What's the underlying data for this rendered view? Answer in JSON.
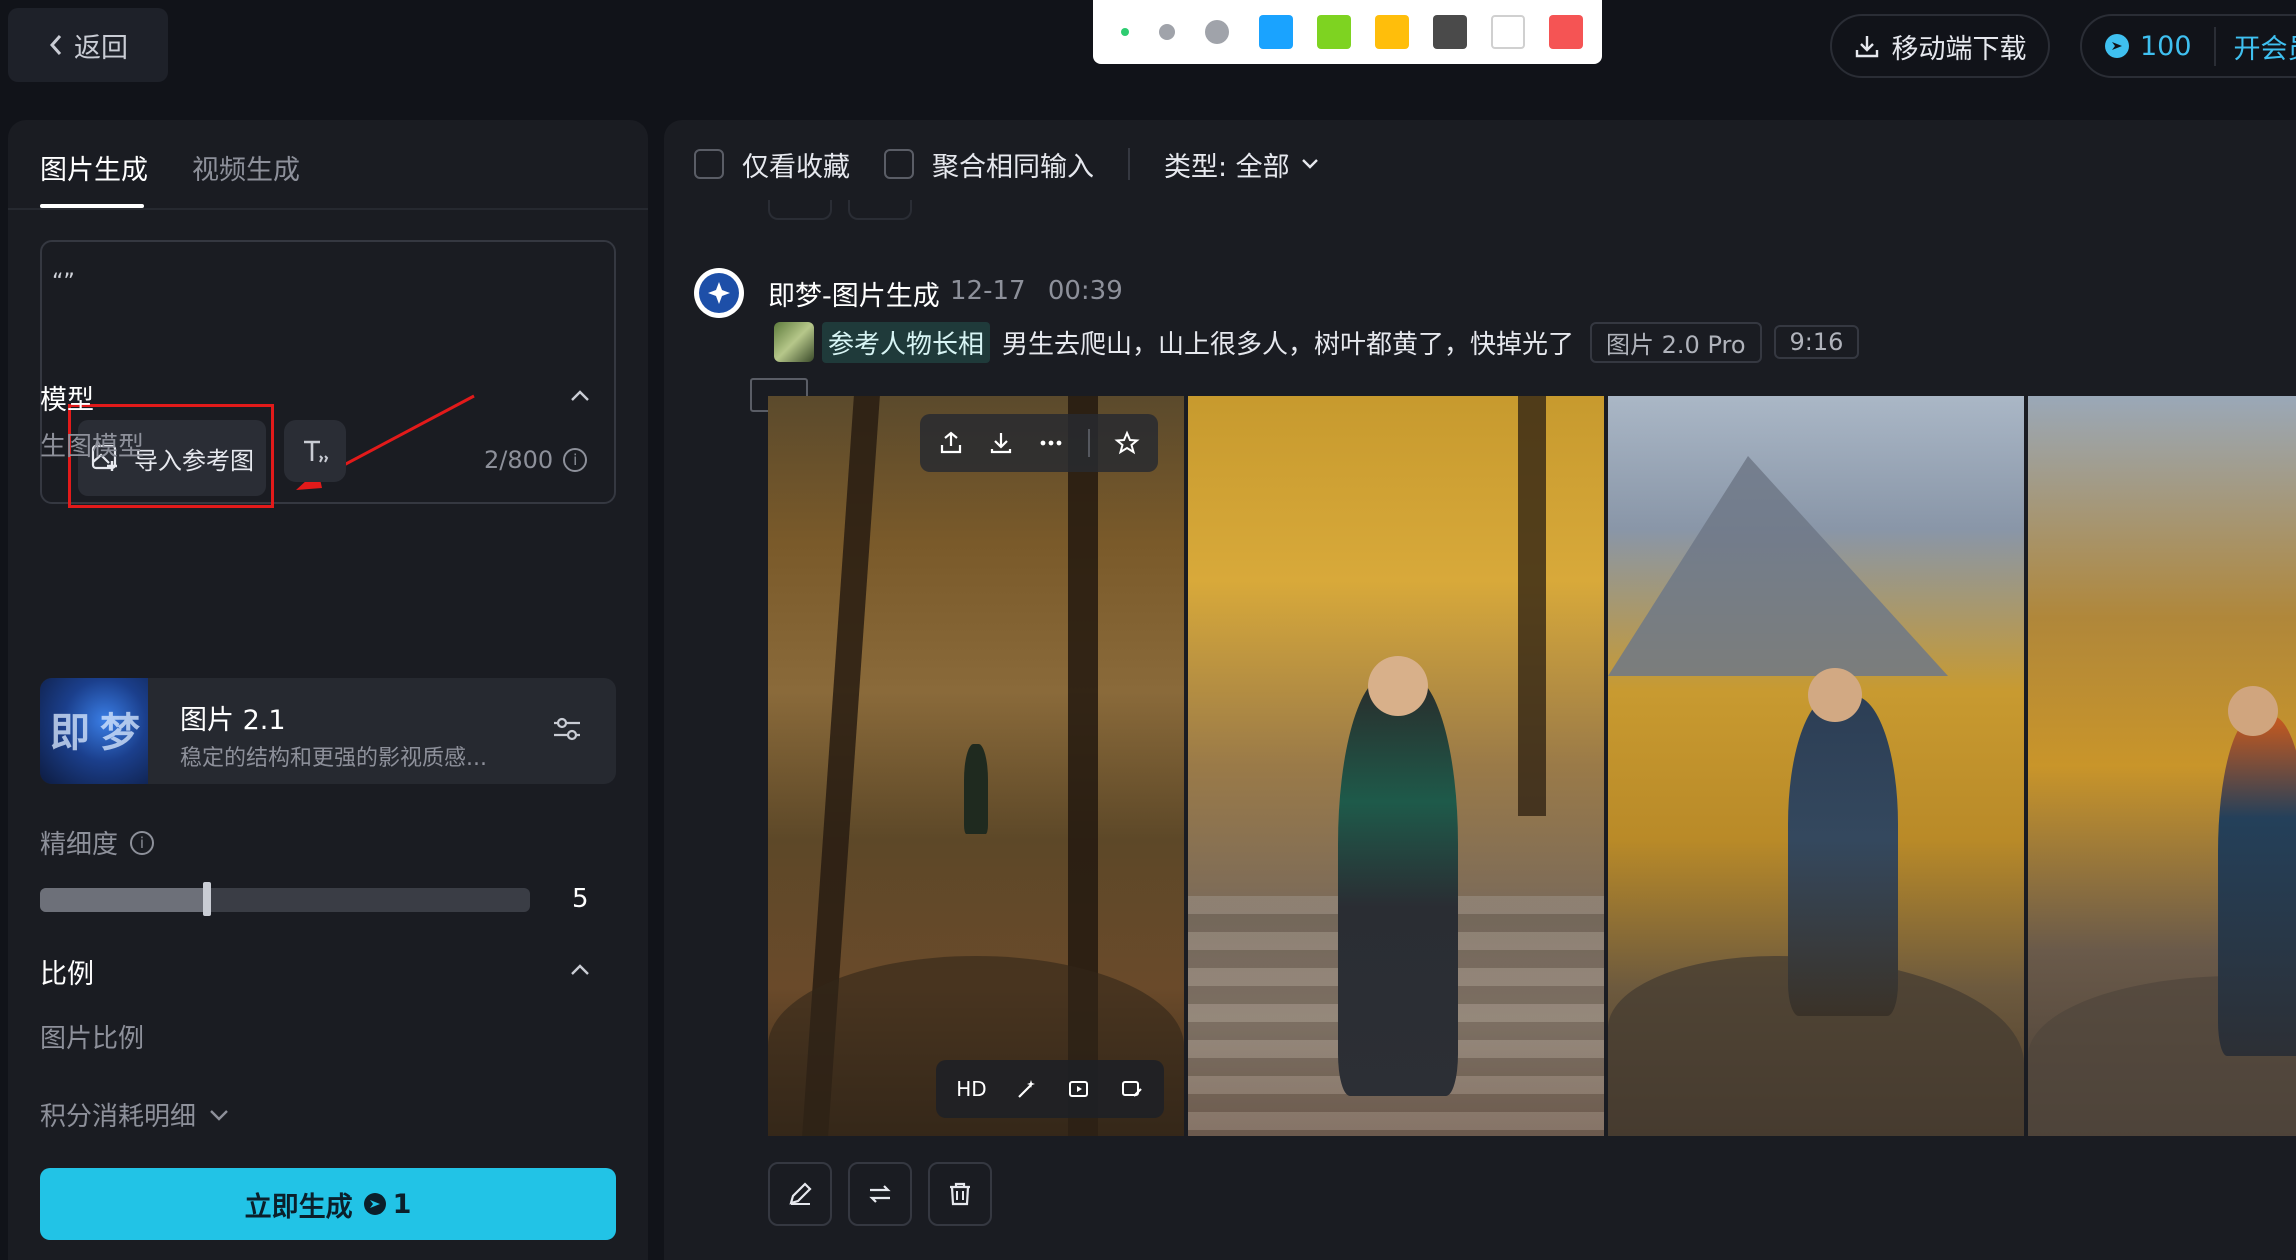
{
  "topbar": {
    "back_label": "返回",
    "palette": {
      "dots": [
        "#2ecc71",
        "#a0a3aa",
        "#a0a3aa"
      ],
      "swatches": [
        "#1aa3ff",
        "#7ed321",
        "#ffbe0b",
        "#4a4a4a",
        "#ffffff",
        "#f55454"
      ]
    },
    "mobile_download_label": "移动端下载",
    "credits_value": "100",
    "vip_label": "开会员"
  },
  "left_panel": {
    "tabs": [
      {
        "label": "图片生成",
        "active": true
      },
      {
        "label": "视频生成",
        "active": false
      }
    ],
    "prompt": {
      "value": "“”",
      "import_label": "导入参考图",
      "counter": "2/800"
    },
    "model_section": {
      "title": "模型",
      "sub_label": "生图模型",
      "model_name": "图片 2.1",
      "model_desc": "稳定的结构和更强的影视质感...",
      "thumb_text": [
        "即",
        "梦"
      ]
    },
    "precision": {
      "label": "精细度",
      "value": "5",
      "fraction": 0.34
    },
    "ratio_section": {
      "title": "比例",
      "sub_label": "图片比例"
    },
    "cost_detail_label": "积分消耗明细",
    "generate": {
      "label": "立即生成",
      "cost": "1"
    }
  },
  "right_panel": {
    "filters": {
      "favorites_label": "仅看收藏",
      "merge_label": "聚合相同输入",
      "type_label": "类型: 全部"
    },
    "message": {
      "author": "即梦-图片生成",
      "date": "12-17",
      "time": "00:39",
      "ref_tag": "参考人物长相",
      "prompt": "男生去爬山，山上很多人，树叶都黄了，快掉光了",
      "model_chip": "图片 2.0 Pro",
      "ratio_chip": "9:16"
    },
    "image_toolbar_bottom": {
      "hd_label": "HD"
    }
  },
  "colors": {
    "accent": "#22c3e6",
    "highlight": "#e21a1a",
    "background": "#111319",
    "panel": "#1a1c22"
  },
  "icons": [
    "chevron-left-icon",
    "download-icon",
    "lightning-coin-icon",
    "image-add-icon",
    "text-style-icon",
    "info-icon",
    "chevron-up-icon",
    "settings-sliders-icon",
    "chevron-down-icon",
    "share-icon",
    "more-icon",
    "star-icon",
    "wand-icon",
    "video-icon",
    "edit-image-icon",
    "pencil-icon",
    "regenerate-icon",
    "trash-icon"
  ]
}
